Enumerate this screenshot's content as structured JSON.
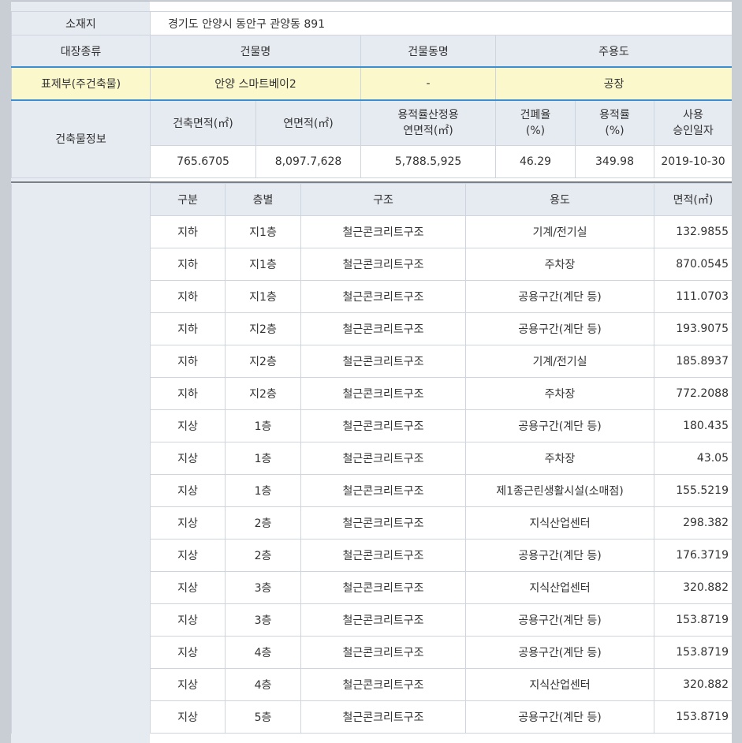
{
  "header": {
    "location_label": "소재지",
    "location_value": "경기도 안양시 동안구 관양동 891",
    "register_type_label": "대장종류",
    "building_name_label": "건물명",
    "building_dong_label": "건물동명",
    "main_use_label": "주용도",
    "register_type_value": "표제부(주건축물)",
    "building_name_value": "안양 스마트베이2",
    "building_dong_value": "-",
    "main_use_value": "공장",
    "building_info_label": "건축물정보",
    "cols": {
      "building_area": "건축면적(㎡)",
      "total_floor_area": "연면적(㎡)",
      "far_area_line1": "용적률산정용",
      "far_area_line2": "연면적(㎡)",
      "coverage_line1": "건폐율",
      "coverage_line2": "(%)",
      "far_line1": "용적률",
      "far_line2": "(%)",
      "approval_line1": "사용",
      "approval_line2": "승인일자"
    },
    "values": {
      "building_area": "765.6705",
      "total_floor_area": "8,097.7,628",
      "far_area": "5,788.5,925",
      "coverage": "46.29",
      "far": "349.98",
      "approval_date": "2019-10-30"
    }
  },
  "floors": {
    "columns": [
      "구분",
      "층별",
      "구조",
      "용도",
      "면적(㎡)"
    ],
    "rows": [
      {
        "type": "지하",
        "floor": "지1층",
        "structure": "철근콘크리트구조",
        "use": "기계/전기실",
        "area": "132.9855"
      },
      {
        "type": "지하",
        "floor": "지1층",
        "structure": "철근콘크리트구조",
        "use": "주차장",
        "area": "870.0545"
      },
      {
        "type": "지하",
        "floor": "지1층",
        "structure": "철근콘크리트구조",
        "use": "공용구간(계단 등)",
        "area": "111.0703"
      },
      {
        "type": "지하",
        "floor": "지2층",
        "structure": "철근콘크리트구조",
        "use": "공용구간(계단 등)",
        "area": "193.9075"
      },
      {
        "type": "지하",
        "floor": "지2층",
        "structure": "철근콘크리트구조",
        "use": "기계/전기실",
        "area": "185.8937"
      },
      {
        "type": "지하",
        "floor": "지2층",
        "structure": "철근콘크리트구조",
        "use": "주차장",
        "area": "772.2088"
      },
      {
        "type": "지상",
        "floor": "1층",
        "structure": "철근콘크리트구조",
        "use": "공용구간(계단 등)",
        "area": "180.435"
      },
      {
        "type": "지상",
        "floor": "1층",
        "structure": "철근콘크리트구조",
        "use": "주차장",
        "area": "43.05"
      },
      {
        "type": "지상",
        "floor": "1층",
        "structure": "철근콘크리트구조",
        "use": "제1종근린생활시설(소매점)",
        "area": "155.5219"
      },
      {
        "type": "지상",
        "floor": "2층",
        "structure": "철근콘크리트구조",
        "use": "지식산업센터",
        "area": "298.382"
      },
      {
        "type": "지상",
        "floor": "2층",
        "structure": "철근콘크리트구조",
        "use": "공용구간(계단 등)",
        "area": "176.3719"
      },
      {
        "type": "지상",
        "floor": "3층",
        "structure": "철근콘크리트구조",
        "use": "지식산업센터",
        "area": "320.882"
      },
      {
        "type": "지상",
        "floor": "3층",
        "structure": "철근콘크리트구조",
        "use": "공용구간(계단 등)",
        "area": "153.8719"
      },
      {
        "type": "지상",
        "floor": "4층",
        "structure": "철근콘크리트구조",
        "use": "공용구간(계단 등)",
        "area": "153.8719"
      },
      {
        "type": "지상",
        "floor": "4층",
        "structure": "철근콘크리트구조",
        "use": "지식산업센터",
        "area": "320.882"
      },
      {
        "type": "지상",
        "floor": "5층",
        "structure": "철근콘크리트구조",
        "use": "공용구간(계단 등)",
        "area": "153.8719"
      }
    ]
  },
  "colors": {
    "header_bg": "#e6eaf1",
    "highlight_row": "#fbf8cc",
    "accent_line": "#3b8fd0",
    "frame_bg": "#c9cdd4"
  }
}
